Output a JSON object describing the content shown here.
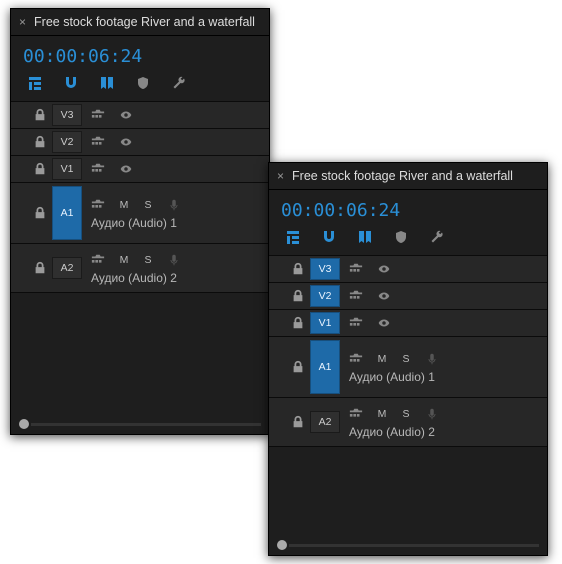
{
  "colors": {
    "accent": "#2a8fd6",
    "accent_fill": "#1e6aa8",
    "panel_bg": "#1e1e1e",
    "track_bg": "#272727"
  },
  "panels": [
    {
      "tab": {
        "title": "Free stock footage River and a waterfall"
      },
      "timecode": "00:00:06:24",
      "v_tag_selected": false,
      "video_tracks": [
        {
          "tag": "V3"
        },
        {
          "tag": "V2"
        },
        {
          "tag": "V1"
        }
      ],
      "audio_tracks": [
        {
          "tag": "A1",
          "label": "Аудио (Audio) 1",
          "mute": "M",
          "solo": "S",
          "tall": true
        },
        {
          "tag": "A2",
          "label": "Аудио (Audio) 2",
          "mute": "M",
          "solo": "S",
          "tall": false
        }
      ]
    },
    {
      "tab": {
        "title": "Free stock footage River and a waterfall"
      },
      "timecode": "00:00:06:24",
      "v_tag_selected": true,
      "video_tracks": [
        {
          "tag": "V3"
        },
        {
          "tag": "V2"
        },
        {
          "tag": "V1"
        }
      ],
      "audio_tracks": [
        {
          "tag": "A1",
          "label": "Аудио (Audio) 1",
          "mute": "M",
          "solo": "S",
          "tall": true
        },
        {
          "tag": "A2",
          "label": "Аудио (Audio) 2",
          "mute": "M",
          "solo": "S",
          "tall": false
        }
      ]
    }
  ]
}
